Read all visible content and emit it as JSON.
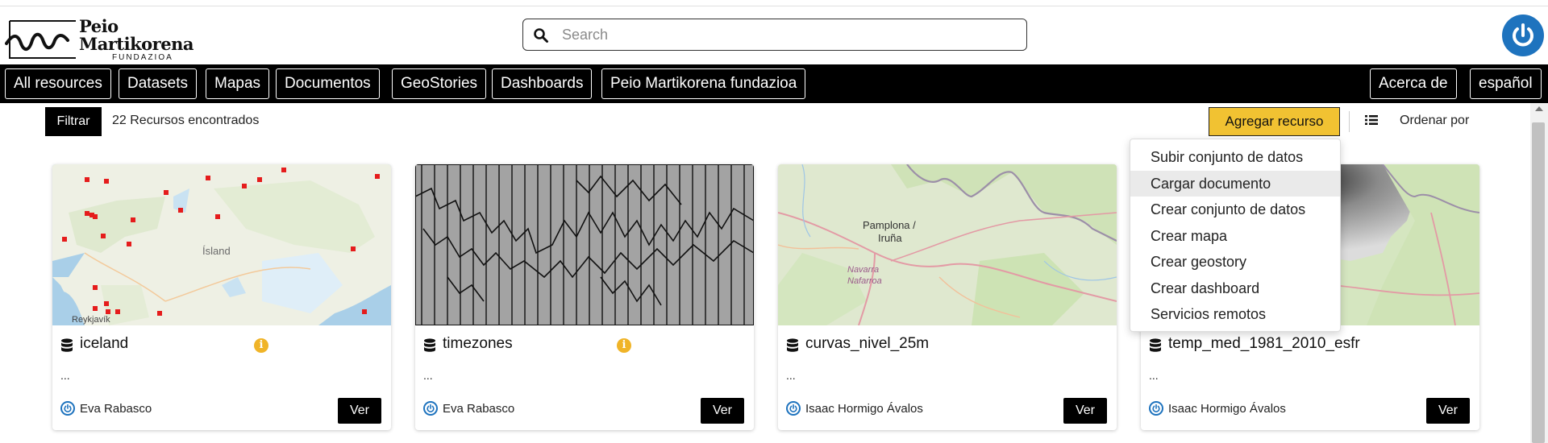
{
  "brand": {
    "line1": "Peio",
    "line2": "Martikorena",
    "line3": "FUNDAZIOA"
  },
  "search": {
    "placeholder": "Search",
    "value": ""
  },
  "nav": {
    "items": [
      "All resources",
      "Datasets",
      "Mapas",
      "Documentos",
      "GeoStories",
      "Dashboards",
      "Peio Martikorena fundazioa"
    ],
    "right": [
      "Acerca de",
      "español"
    ]
  },
  "toolbar": {
    "filter_label": "Filtrar",
    "count_text": "22 Recursos encontrados",
    "add_label": "Agregar recurso",
    "sort_label": "Ordenar por"
  },
  "dropdown": {
    "items": [
      "Subir conjunto de datos",
      "Cargar documento",
      "Crear conjunto de datos",
      "Crear mapa",
      "Crear geostory",
      "Crear dashboard",
      "Servicios remotos"
    ],
    "highlighted": "Cargar documento"
  },
  "cards": [
    {
      "title": "iceland",
      "description": "...",
      "author": "Eva Rabasco",
      "action": "Ver",
      "info_icon": true,
      "map_labels": [
        "Ísland",
        "Reykjavík"
      ]
    },
    {
      "title": "timezones",
      "description": "...",
      "author": "Eva Rabasco",
      "action": "Ver",
      "info_icon": true
    },
    {
      "title": "curvas_nivel_25m",
      "description": "...",
      "author": "Isaac Hormigo Ávalos",
      "action": "Ver",
      "info_icon": false,
      "map_labels": [
        "Pamplona /",
        "Iruña",
        "Navarra",
        "Nafarroa"
      ]
    },
    {
      "title": "temp_med_1981_2010_esfr",
      "description": "...",
      "author": "Isaac Hormigo Ávalos",
      "action": "Ver",
      "info_icon": false
    }
  ],
  "colors": {
    "accent_yellow": "#f1c232",
    "brand_blue": "#1e73be",
    "nav_bg": "#000000"
  }
}
